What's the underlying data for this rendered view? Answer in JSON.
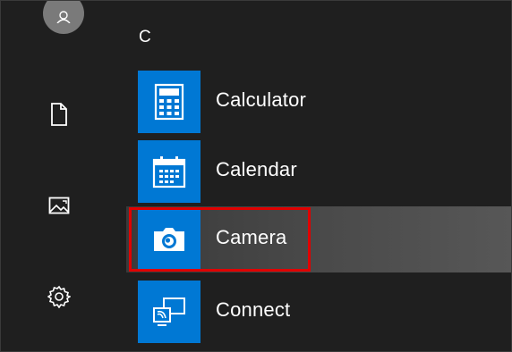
{
  "start_menu": {
    "section_letter": "C",
    "apps": [
      {
        "label": "Calculator",
        "icon": "calculator-icon"
      },
      {
        "label": "Calendar",
        "icon": "calendar-icon"
      },
      {
        "label": "Camera",
        "icon": "camera-icon",
        "highlighted": true
      },
      {
        "label": "Connect",
        "icon": "connect-icon"
      }
    ]
  },
  "rail": {
    "icons": [
      "user-avatar-icon",
      "document-icon",
      "pictures-icon",
      "settings-gear-icon"
    ]
  },
  "colors": {
    "tile_blue": "#0078d4",
    "background": "#1f1f1f",
    "highlight_outline": "#e00000"
  }
}
